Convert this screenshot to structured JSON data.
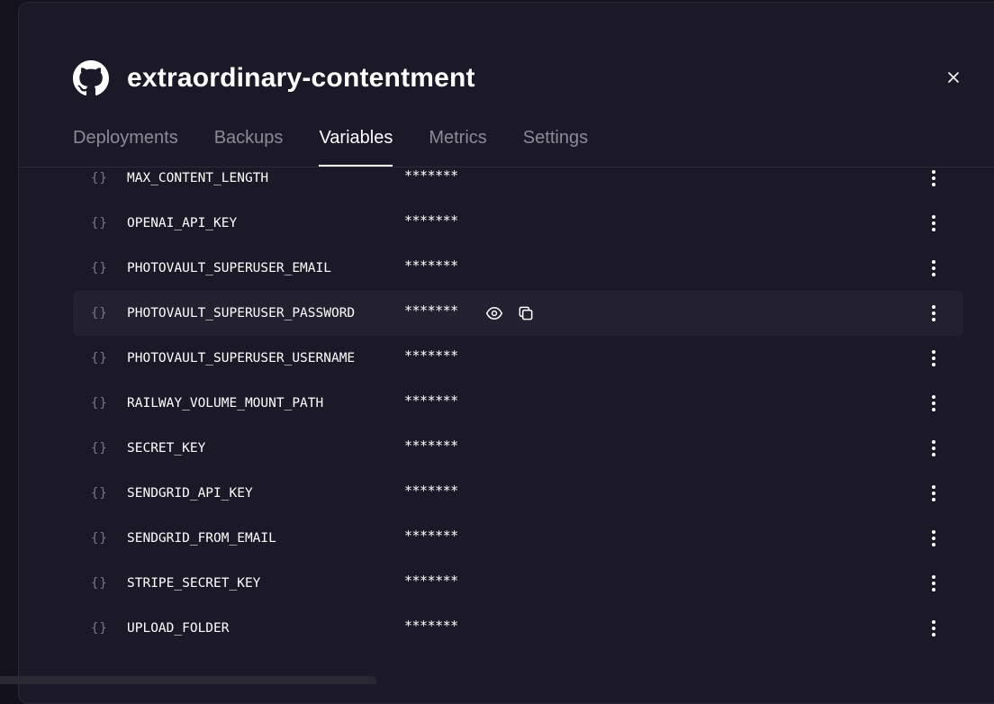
{
  "modal": {
    "title": "extraordinary-contentment",
    "tabs": [
      {
        "label": "Deployments",
        "active": false
      },
      {
        "label": "Backups",
        "active": false
      },
      {
        "label": "Variables",
        "active": true
      },
      {
        "label": "Metrics",
        "active": false
      },
      {
        "label": "Settings",
        "active": false
      }
    ]
  },
  "icons": {
    "brand": "github-icon",
    "close": "close-icon",
    "variable": "braces-icon",
    "reveal": "eye-icon",
    "copy": "copy-icon",
    "more": "more-vertical-icon"
  },
  "variable_icon_glyph": "{}",
  "variables": [
    {
      "name": "MAX_CONTENT_LENGTH",
      "value": "*******"
    },
    {
      "name": "OPENAI_API_KEY",
      "value": "*******"
    },
    {
      "name": "PHOTOVAULT_SUPERUSER_EMAIL",
      "value": "*******"
    },
    {
      "name": "PHOTOVAULT_SUPERUSER_PASSWORD",
      "value": "*******",
      "hovered": true
    },
    {
      "name": "PHOTOVAULT_SUPERUSER_USERNAME",
      "value": "*******"
    },
    {
      "name": "RAILWAY_VOLUME_MOUNT_PATH",
      "value": "*******"
    },
    {
      "name": "SECRET_KEY",
      "value": "*******"
    },
    {
      "name": "SENDGRID_API_KEY",
      "value": "*******"
    },
    {
      "name": "SENDGRID_FROM_EMAIL",
      "value": "*******"
    },
    {
      "name": "STRIPE_SECRET_KEY",
      "value": "*******"
    },
    {
      "name": "UPLOAD_FOLDER",
      "value": "*******"
    }
  ],
  "colors": {
    "background": "#1b1927",
    "row_hover": "#232130",
    "text": "#ffffff",
    "muted_text": "#8d8a98"
  }
}
